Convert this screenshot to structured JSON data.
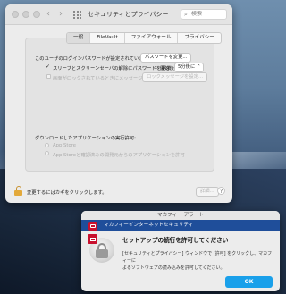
{
  "window": {
    "title": "セキュリティとプライバシー",
    "back_label": "‹",
    "forward_label": "›",
    "search_placeholder": "検索",
    "tabs": [
      {
        "label": "一般"
      },
      {
        "label": "FileVault"
      },
      {
        "label": "ファイアウォール"
      },
      {
        "label": "プライバシー"
      }
    ],
    "general": {
      "login_password_text": "このユーザのログインパスワードが設定されています",
      "change_password_button": "パスワードを変更...",
      "require_password_check": "✓",
      "require_password_label": "スリープとスクリーンセーバの解除にパスワードを要求",
      "require_password_after": "開始後",
      "require_password_delay": "5分後に",
      "lock_message_label": "画面がロックされているときにメッセージを表示",
      "lock_message_button": "ロックメッセージを設定...",
      "allow_apps_heading": "ダウンロードしたアプリケーションの実行許可:",
      "option_app_store": "App Store",
      "option_app_store_and_devs": "App Storeと確認済みの開発元からのアプリケーションを許可"
    },
    "bottom": {
      "lock_text": "変更するにはカギをクリックします。",
      "advanced_button": "詳細...",
      "help_label": "?"
    }
  },
  "alert": {
    "window_title": "マカフィー アラート",
    "brand_bar": "マカフィーインターネットセキュリティ",
    "heading": "セットアップの続行を許可してください",
    "body_line1": "[セキュリティとプライバシー] ウィンドウで [許可] をクリックし、マカフィーに",
    "body_line2": "よるソフトウェアの読み込みを許可してください。",
    "ok_button": "OK"
  }
}
